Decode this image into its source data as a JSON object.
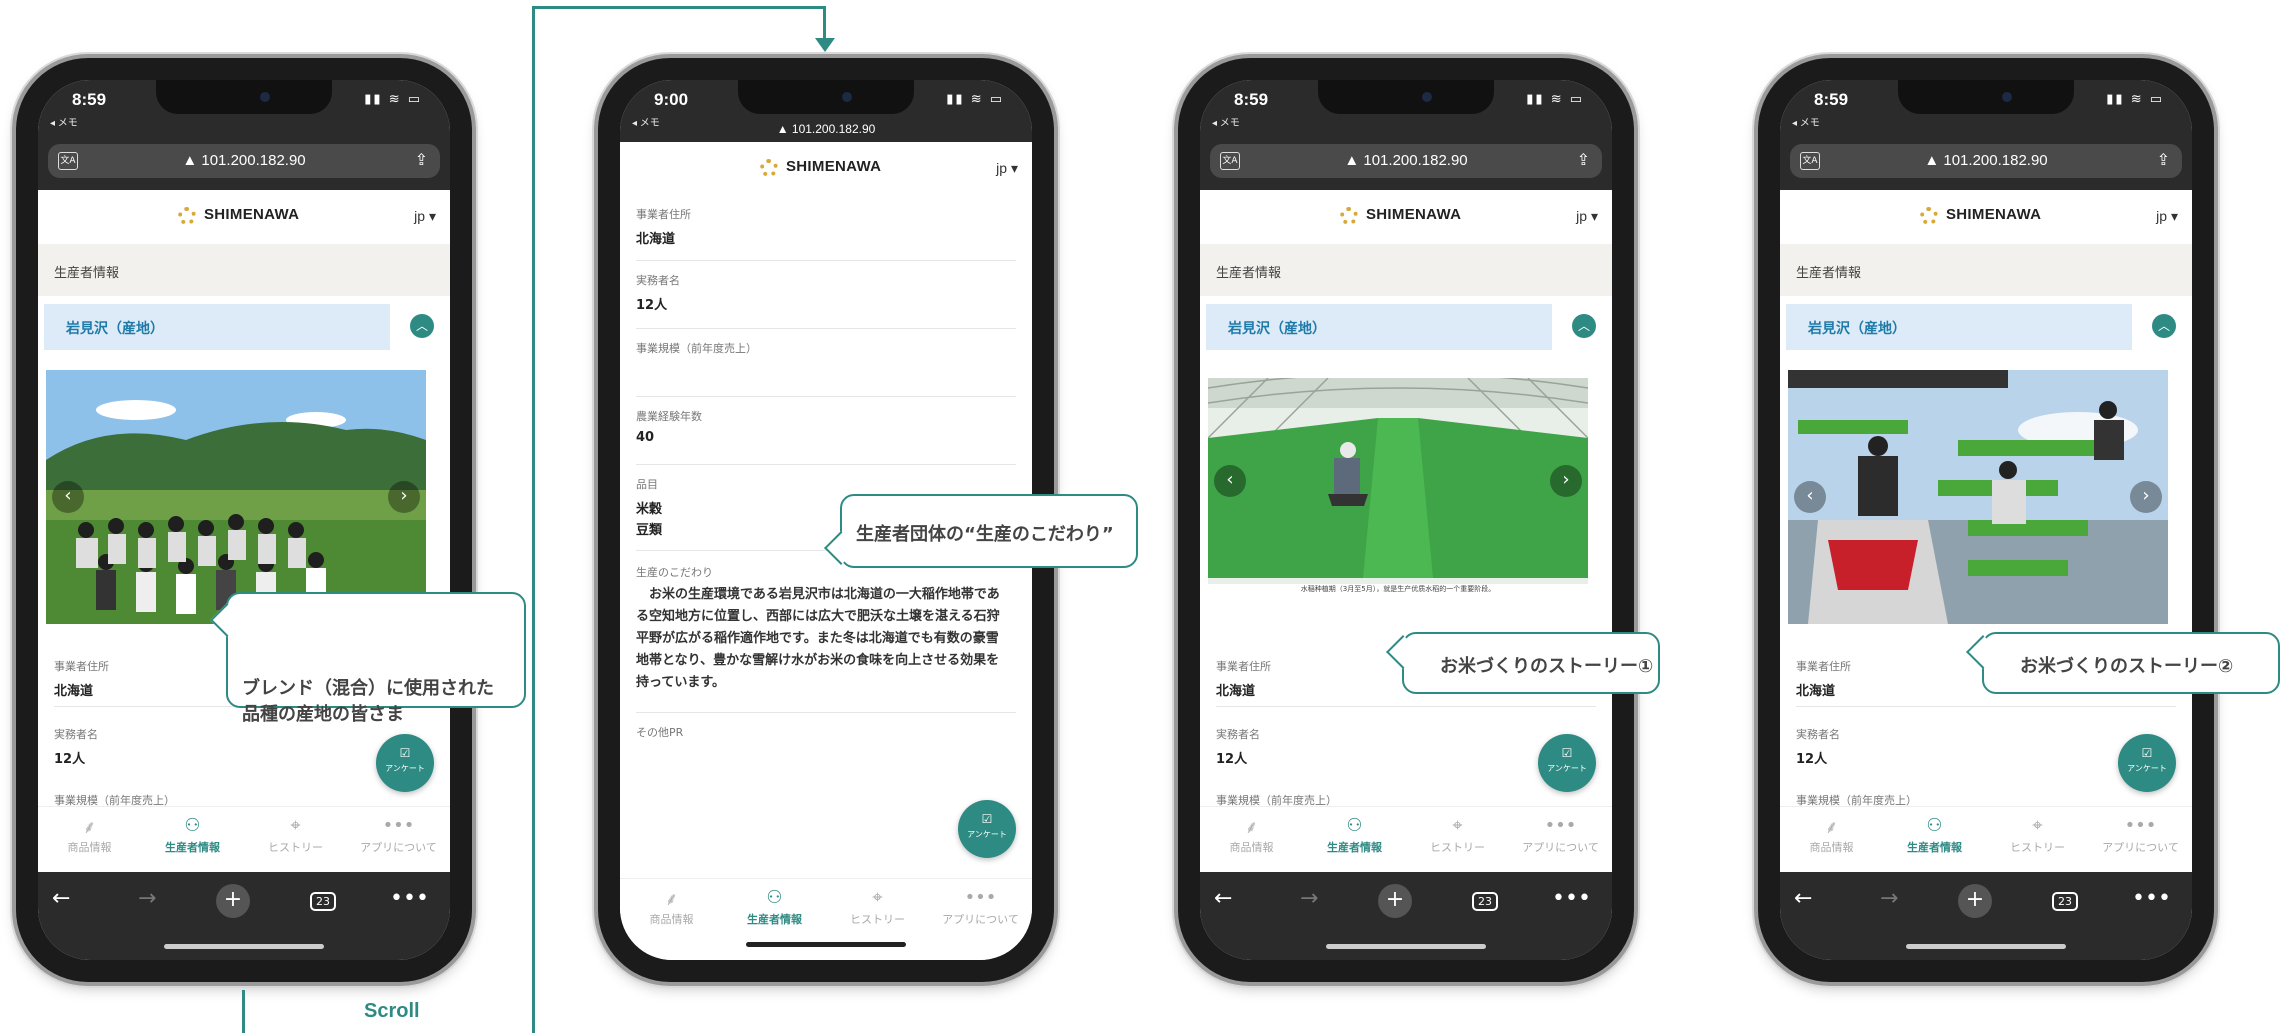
{
  "common": {
    "logo": "SHIMENAWA",
    "lang": "jp",
    "back_label": "◂ メモ",
    "url": "▲ 101.200.182.90",
    "section_title": "生産者情報",
    "region_title": "岩見沢（産地）",
    "fab_label": "アンケート",
    "tabs": [
      "商品情報",
      "生産者情報",
      "ヒストリー",
      "アプリについて"
    ],
    "tab_count": "23"
  },
  "phone1": {
    "time": "8:59",
    "fields": [
      {
        "label": "事業者住所",
        "value": "北海道"
      },
      {
        "label": "実務者名",
        "value": "12人"
      },
      {
        "label": "事業規模（前年度売上）",
        "value": ""
      }
    ]
  },
  "phone2": {
    "time": "9:00",
    "fields": [
      {
        "label": "事業者住所",
        "value": "北海道"
      },
      {
        "label": "実務者名",
        "value": "12人"
      },
      {
        "label": "事業規模（前年度売上）",
        "value": ""
      },
      {
        "label": "農業経験年数",
        "value": "40"
      },
      {
        "label": "品目",
        "value": "米穀",
        "value2": "豆類"
      },
      {
        "label": "生産のこだわり",
        "value": "お米の生産環境である岩見沢市は北海道の一大稲作地帯である空知地方に位置し、西部には広大で肥沃な土壌を湛える石狩平野が広がる稲作適作地です。また冬は北海道でも有数の豪雪地帯となり、豊かな雪解け水がお米の食味を向上させる効果を持っています。"
      },
      {
        "label": "その他PR",
        "value": ""
      }
    ]
  },
  "phone3": {
    "time": "8:59",
    "caption": "水稲种植期（3月至5月），就是生产优质水稻的一个重要阶段。",
    "fields": [
      {
        "label": "事業者住所",
        "value": "北海道"
      },
      {
        "label": "実務者名",
        "value": "12人"
      },
      {
        "label": "事業規模（前年度売上）",
        "value": ""
      }
    ]
  },
  "phone4": {
    "time": "8:59",
    "fields": [
      {
        "label": "事業者住所",
        "value": "北海道"
      },
      {
        "label": "実務者名",
        "value": "12人"
      },
      {
        "label": "事業規模（前年度売上）",
        "value": ""
      }
    ]
  },
  "callouts": {
    "blend": "ブレンド（混合）に使用された\n品種の産地の皆さま",
    "kodawari": "生産者団体の“生産のこだわり”",
    "story1": "お米づくりのストーリー①",
    "story2": "お米づくりのストーリー②"
  },
  "scroll_label": "Scroll",
  "colors": {
    "accent": "#2e8b84",
    "region_bg": "#dcebf7",
    "region_text": "#1f7aa8"
  }
}
